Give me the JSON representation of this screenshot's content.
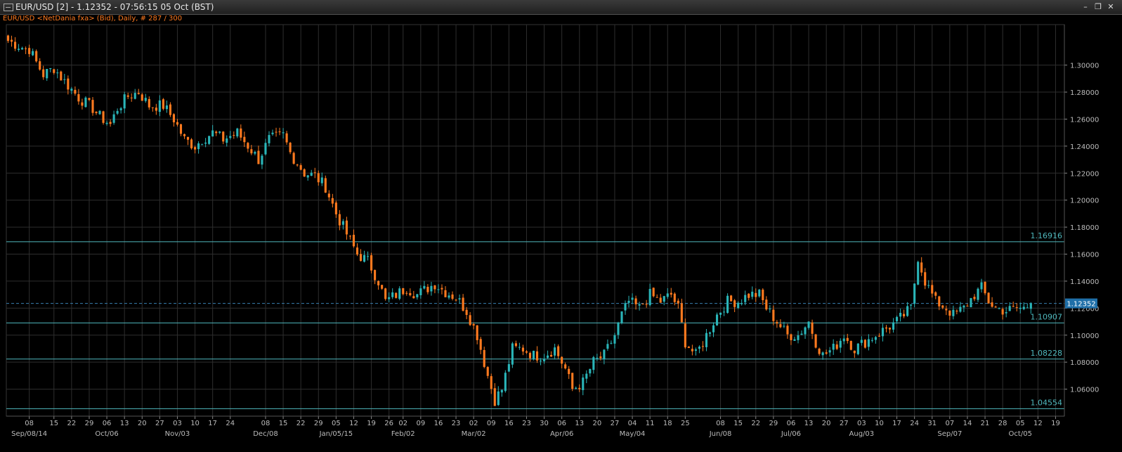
{
  "window": {
    "title": "EUR/USD [2] - 1.12352 - 07:56:15  05 Oct (BST)",
    "minimize_icon": "minimize-icon",
    "restore_icon": "restore-icon",
    "close_icon": "close-icon"
  },
  "chart_data": {
    "type": "candlestick",
    "subtitle": "EUR/USD <NetDania fxa> (Bid), Daily, # 287 / 300",
    "colors": {
      "up": "#2ab5b8",
      "down": "#ff7a1f",
      "grid": "#2e2e2e",
      "level": "#4fb8bd",
      "current": "#3a7fb0",
      "background": "#000000"
    },
    "y_range": [
      1.04,
      1.33
    ],
    "y_ticks": [
      "1.30000",
      "1.28000",
      "1.26000",
      "1.24000",
      "1.22000",
      "1.20000",
      "1.18000",
      "1.16000",
      "1.14000",
      "1.12000",
      "1.10000",
      "1.08000",
      "1.06000"
    ],
    "y_tick_values": [
      1.3,
      1.28,
      1.26,
      1.24,
      1.22,
      1.2,
      1.18,
      1.16,
      1.14,
      1.12,
      1.1,
      1.08,
      1.06
    ],
    "current_price": {
      "label": "1.12352",
      "value": 1.12352
    },
    "levels": [
      {
        "label": "1.16916",
        "value": 1.16916
      },
      {
        "label": "1.10907",
        "value": 1.10907
      },
      {
        "label": "1.08228",
        "value": 1.08228
      },
      {
        "label": "1.04554",
        "value": 1.04554
      }
    ],
    "x_day_ticks": [
      "08",
      "15",
      "22",
      "29",
      "06",
      "13",
      "20",
      "27",
      "03",
      "10",
      "17",
      "24",
      "08",
      "15",
      "22",
      "29",
      "05",
      "12",
      "19",
      "26",
      "02",
      "09",
      "16",
      "23",
      "02",
      "09",
      "16",
      "23",
      "30",
      "06",
      "13",
      "20",
      "27",
      "04",
      "11",
      "18",
      "25",
      "08",
      "15",
      "22",
      "29",
      "06",
      "13",
      "20",
      "27",
      "03",
      "10",
      "17",
      "24",
      "31",
      "07",
      "14",
      "21",
      "28",
      "05",
      "12",
      "19"
    ],
    "x_day_tick_index": [
      6,
      13,
      18,
      23,
      28,
      33,
      38,
      43,
      48,
      53,
      58,
      63,
      73,
      78,
      83,
      88,
      93,
      98,
      103,
      108,
      112,
      117,
      122,
      127,
      132,
      137,
      142,
      147,
      152,
      157,
      162,
      167,
      172,
      177,
      182,
      187,
      192,
      202,
      207,
      212,
      217,
      222,
      227,
      232,
      237,
      242,
      247,
      252,
      257,
      262,
      267,
      272,
      277,
      282,
      287,
      292,
      297
    ],
    "x_month_ticks": [
      "Sep/08/14",
      "Oct/06",
      "Nov/03",
      "Dec/08",
      "Jan/05/15",
      "Feb/02",
      "Mar/02",
      "Apr/06",
      "May/04",
      "Jun/08",
      "Jul/06",
      "Aug/03",
      "Sep/07",
      "Oct/05"
    ],
    "x_month_tick_index": [
      6,
      28,
      48,
      73,
      93,
      112,
      132,
      157,
      177,
      202,
      222,
      242,
      267,
      287
    ],
    "total_slots": 300,
    "anchors": [
      [
        0,
        1.318
      ],
      [
        5,
        1.312
      ],
      [
        6,
        1.312
      ],
      [
        8,
        1.302
      ],
      [
        10,
        1.293
      ],
      [
        13,
        1.298
      ],
      [
        15,
        1.291
      ],
      [
        18,
        1.282
      ],
      [
        20,
        1.276
      ],
      [
        24,
        1.268
      ],
      [
        26,
        1.262
      ],
      [
        29,
        1.256
      ],
      [
        31,
        1.268
      ],
      [
        34,
        1.277
      ],
      [
        37,
        1.28
      ],
      [
        40,
        1.27
      ],
      [
        44,
        1.27
      ],
      [
        47,
        1.26
      ],
      [
        50,
        1.245
      ],
      [
        53,
        1.24
      ],
      [
        55,
        1.245
      ],
      [
        58,
        1.25
      ],
      [
        61,
        1.245
      ],
      [
        65,
        1.25
      ],
      [
        69,
        1.237
      ],
      [
        71,
        1.23
      ],
      [
        74,
        1.245
      ],
      [
        78,
        1.248
      ],
      [
        80,
        1.235
      ],
      [
        84,
        1.22
      ],
      [
        87,
        1.218
      ],
      [
        90,
        1.21
      ],
      [
        93,
        1.19
      ],
      [
        96,
        1.175
      ],
      [
        99,
        1.16
      ],
      [
        102,
        1.155
      ],
      [
        105,
        1.14
      ],
      [
        107,
        1.125
      ],
      [
        110,
        1.13
      ],
      [
        113,
        1.135
      ],
      [
        116,
        1.13
      ],
      [
        119,
        1.135
      ],
      [
        121,
        1.138
      ],
      [
        124,
        1.132
      ],
      [
        127,
        1.128
      ],
      [
        130,
        1.118
      ],
      [
        133,
        1.1
      ],
      [
        136,
        1.07
      ],
      [
        138,
        1.052
      ],
      [
        140,
        1.06
      ],
      [
        143,
        1.09
      ],
      [
        146,
        1.09
      ],
      [
        149,
        1.085
      ],
      [
        152,
        1.085
      ],
      [
        155,
        1.09
      ],
      [
        158,
        1.075
      ],
      [
        160,
        1.06
      ],
      [
        163,
        1.065
      ],
      [
        166,
        1.08
      ],
      [
        169,
        1.085
      ],
      [
        172,
        1.1
      ],
      [
        174,
        1.115
      ],
      [
        176,
        1.125
      ],
      [
        179,
        1.12
      ],
      [
        182,
        1.13
      ],
      [
        185,
        1.125
      ],
      [
        188,
        1.13
      ],
      [
        190,
        1.12
      ],
      [
        192,
        1.095
      ],
      [
        195,
        1.085
      ],
      [
        198,
        1.1
      ],
      [
        201,
        1.115
      ],
      [
        204,
        1.125
      ],
      [
        207,
        1.125
      ],
      [
        210,
        1.13
      ],
      [
        213,
        1.13
      ],
      [
        215,
        1.12
      ],
      [
        218,
        1.11
      ],
      [
        221,
        1.1
      ],
      [
        224,
        1.1
      ],
      [
        227,
        1.11
      ],
      [
        229,
        1.095
      ],
      [
        231,
        1.085
      ],
      [
        234,
        1.09
      ],
      [
        237,
        1.1
      ],
      [
        240,
        1.09
      ],
      [
        243,
        1.095
      ],
      [
        246,
        1.1
      ],
      [
        249,
        1.105
      ],
      [
        252,
        1.11
      ],
      [
        254,
        1.115
      ],
      [
        256,
        1.12
      ],
      [
        258,
        1.158
      ],
      [
        260,
        1.14
      ],
      [
        263,
        1.125
      ],
      [
        266,
        1.12
      ],
      [
        268,
        1.115
      ],
      [
        271,
        1.12
      ],
      [
        274,
        1.13
      ],
      [
        276,
        1.135
      ],
      [
        278,
        1.125
      ],
      [
        280,
        1.12
      ],
      [
        283,
        1.118
      ],
      [
        286,
        1.12
      ],
      [
        288,
        1.12
      ],
      [
        290,
        1.123
      ]
    ]
  }
}
